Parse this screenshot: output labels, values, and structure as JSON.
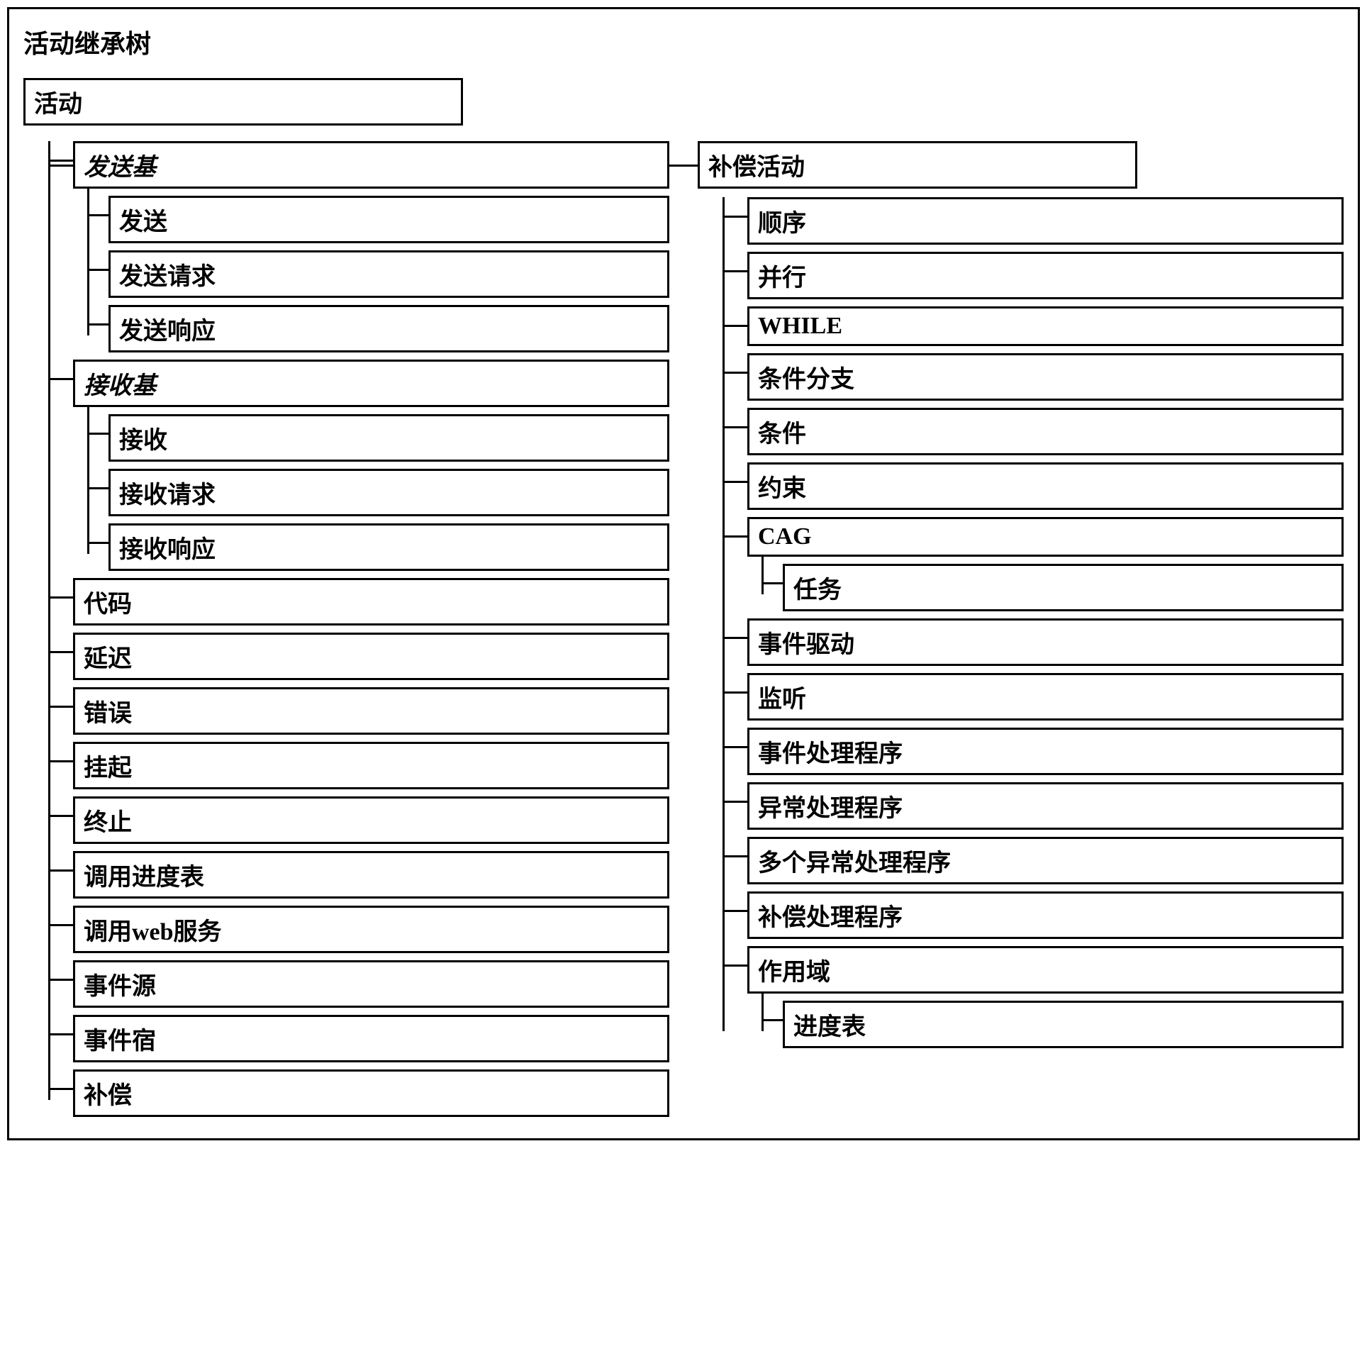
{
  "title": "活动继承树",
  "root": "活动",
  "left": {
    "send_base": "发送基",
    "send": "发送",
    "send_request": "发送请求",
    "send_response": "发送响应",
    "receive_base": "接收基",
    "receive": "接收",
    "receive_request": "接收请求",
    "receive_response": "接收响应",
    "code": "代码",
    "delay": "延迟",
    "error": "错误",
    "suspend": "挂起",
    "terminate": "终止",
    "invoke_schedule": "调用进度表",
    "invoke_web": "调用web服务",
    "event_source": "事件源",
    "event_sink": "事件宿",
    "compensate": "补偿"
  },
  "right": {
    "comp_activity": "补偿活动",
    "sequence": "顺序",
    "parallel": "并行",
    "while": "WHILE",
    "cond_branch": "条件分支",
    "cond": "条件",
    "constraint": "约束",
    "cag": "CAG",
    "task": "任务",
    "event_driven": "事件驱动",
    "listen": "监听",
    "event_handler": "事件处理程序",
    "exception_handler": "异常处理程序",
    "multi_exception_handler": "多个异常处理程序",
    "comp_handler": "补偿处理程序",
    "scope": "作用域",
    "schedule": "进度表"
  }
}
